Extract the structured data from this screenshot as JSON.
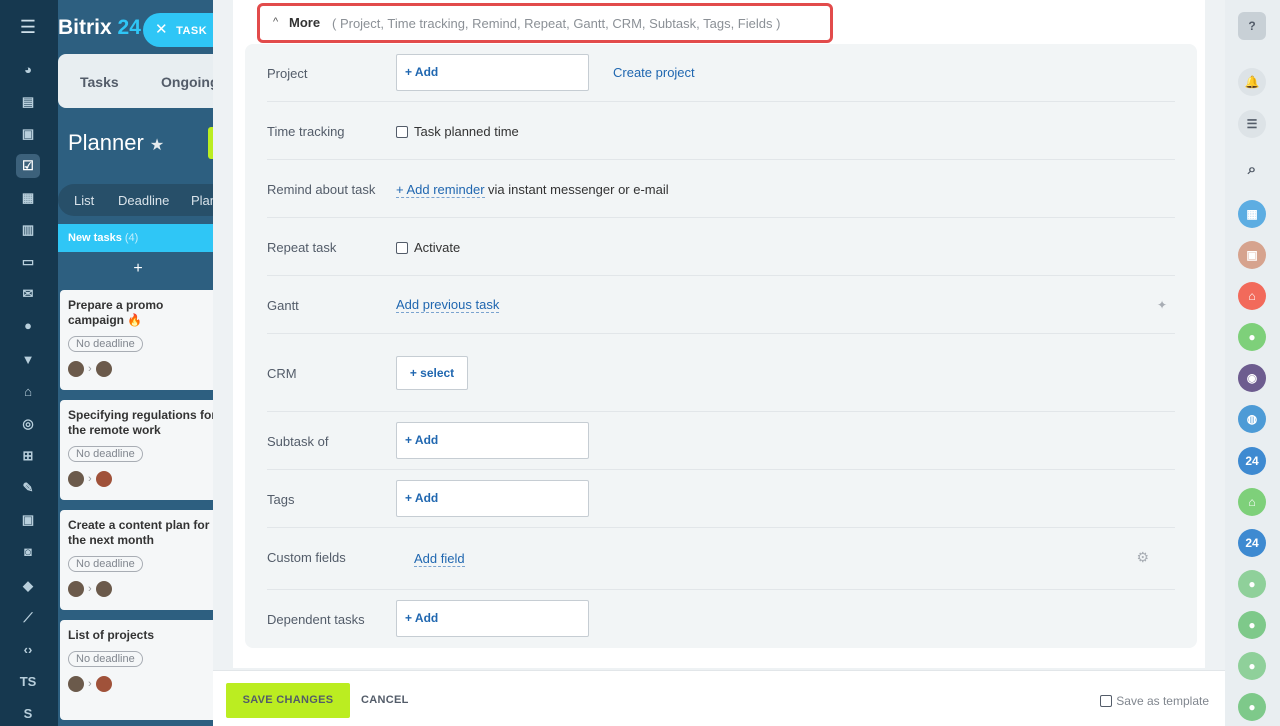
{
  "background": {
    "logo": {
      "text": "Bitrix",
      "num": "24"
    },
    "task_pill": {
      "x": "✕",
      "label": "TASK"
    },
    "tabs": [
      "Tasks",
      "Ongoing"
    ],
    "planner_title": "Planner",
    "view_tabs": [
      "List",
      "Deadline",
      "Plan"
    ],
    "column": {
      "title": "New tasks",
      "count": "(4)",
      "add": "+"
    },
    "cards": [
      {
        "title": "Prepare a promo campaign 🔥",
        "deadline": "No deadline"
      },
      {
        "title": "Specifying regulations for the remote work",
        "deadline": "No deadline"
      },
      {
        "title": "Create a content plan for the next month",
        "deadline": "No deadline"
      },
      {
        "title": "List of projects",
        "deadline": "No deadline"
      }
    ]
  },
  "leftnav": {
    "ts": "TS",
    "s": "S"
  },
  "more": {
    "label": "More",
    "list": "( Project,  Time tracking,  Remind,  Repeat,  Gantt,  CRM,  Subtask,  Tags,  Fields )"
  },
  "fields": {
    "project": {
      "label": "Project",
      "add": "+ Add",
      "create": "Create project"
    },
    "time_tracking": {
      "label": "Time tracking",
      "checkbox": "Task planned time"
    },
    "remind": {
      "label": "Remind about task",
      "link": "+ Add reminder",
      "suffix": "via instant messenger or e-mail"
    },
    "repeat": {
      "label": "Repeat task",
      "checkbox": "Activate"
    },
    "gantt": {
      "label": "Gantt",
      "link": "Add previous task"
    },
    "crm": {
      "label": "CRM",
      "button": "+   select"
    },
    "subtask": {
      "label": "Subtask of",
      "add": "+ Add"
    },
    "tags": {
      "label": "Tags",
      "add": "+ Add"
    },
    "custom": {
      "label": "Custom fields",
      "link": "Add field"
    },
    "dependent": {
      "label": "Dependent tasks",
      "add": "+ Add"
    }
  },
  "footer": {
    "save": "SAVE CHANGES",
    "cancel": "CANCEL",
    "template": "Save as template"
  },
  "rightrail": {
    "help": "?",
    "n24a": "24",
    "n24b": "24"
  },
  "colors": {
    "accent": "#2fc6f6",
    "save": "#bbed21",
    "link": "#2067b0",
    "highlight": "#e24b4b"
  }
}
